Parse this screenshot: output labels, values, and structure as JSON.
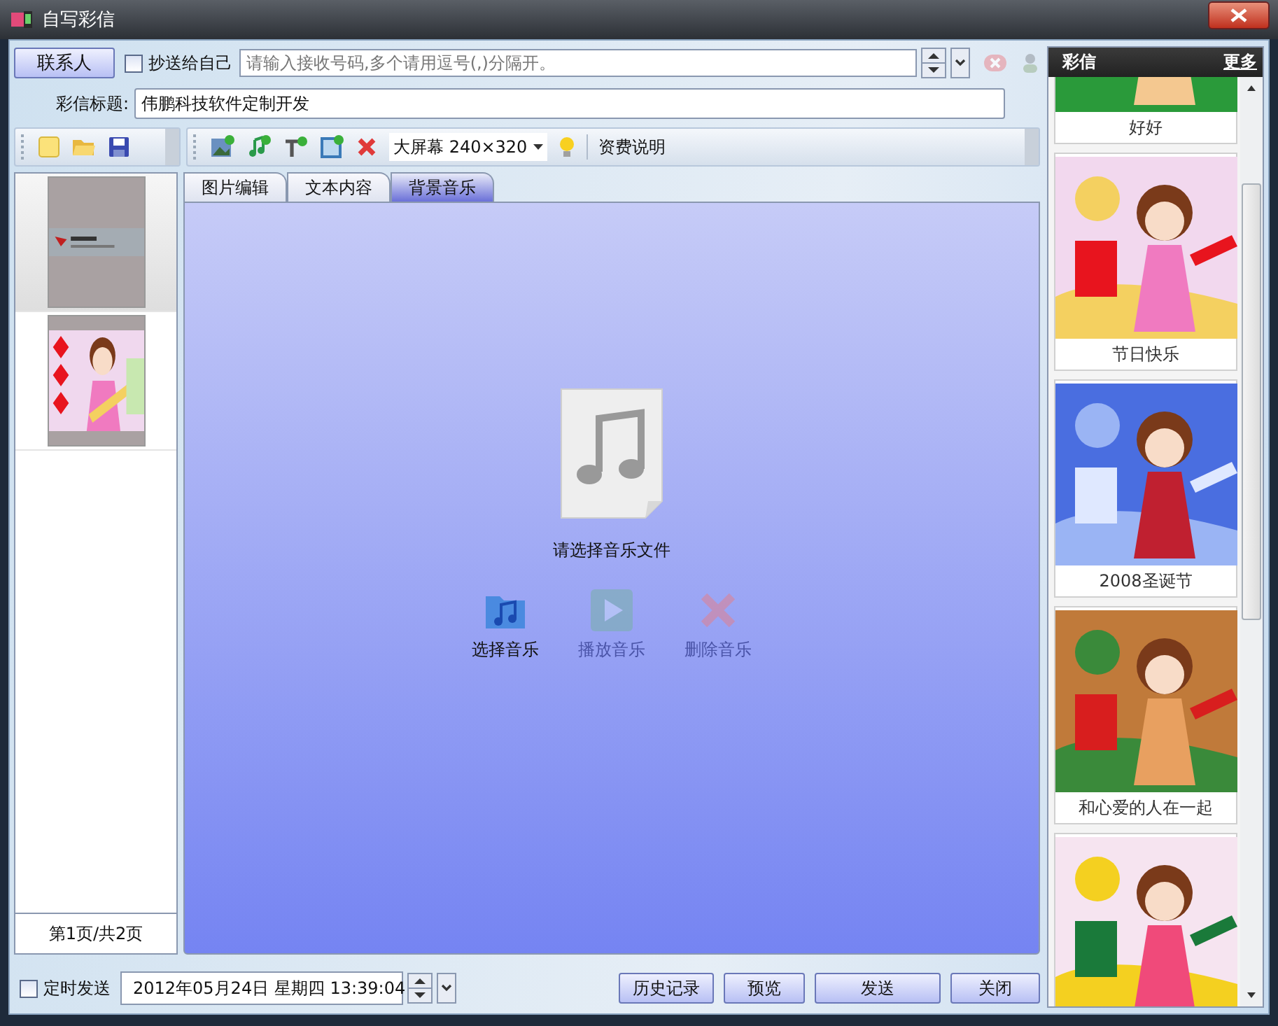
{
  "window": {
    "title": "自写彩信"
  },
  "recipient": {
    "contacts_button": "联系人",
    "cc_self": {
      "label": "抄送给自己",
      "checked": false
    },
    "placeholder": "请输入接收号码,多个请用逗号(,)分隔开。"
  },
  "subject": {
    "label": "彩信标题:",
    "value": "伟鹏科技软件定制开发"
  },
  "toolbar": {
    "screen_size": "大屏幕 240×320",
    "fee_link": "资费说明"
  },
  "slides": [
    {
      "selected": true
    },
    {
      "selected": false
    }
  ],
  "page_indicator": "第1页/共2页",
  "tabs": [
    {
      "label": "图片编辑",
      "selected": false
    },
    {
      "label": "文本内容",
      "selected": false
    },
    {
      "label": "背景音乐",
      "selected": true
    }
  ],
  "music": {
    "prompt": "请选择音乐文件",
    "actions": [
      {
        "label": "选择音乐",
        "disabled": false
      },
      {
        "label": "播放音乐",
        "disabled": true
      },
      {
        "label": "删除音乐",
        "disabled": true
      }
    ]
  },
  "schedule": {
    "label": "定时发送",
    "checked": false,
    "value": "2012年05月24日 星期四 13:39:04"
  },
  "buttons": [
    "历史记录",
    "预览",
    "发送",
    "关闭"
  ],
  "gallery": {
    "title": "彩信",
    "more": "更多",
    "items": [
      {
        "kind": "card",
        "caption": "好好"
      },
      {
        "kind": "card",
        "caption": "节日快乐"
      },
      {
        "kind": "card",
        "caption": "2008圣诞节"
      },
      {
        "kind": "card",
        "caption": "和心爱的人在一起"
      },
      {
        "kind": "picture"
      }
    ]
  }
}
